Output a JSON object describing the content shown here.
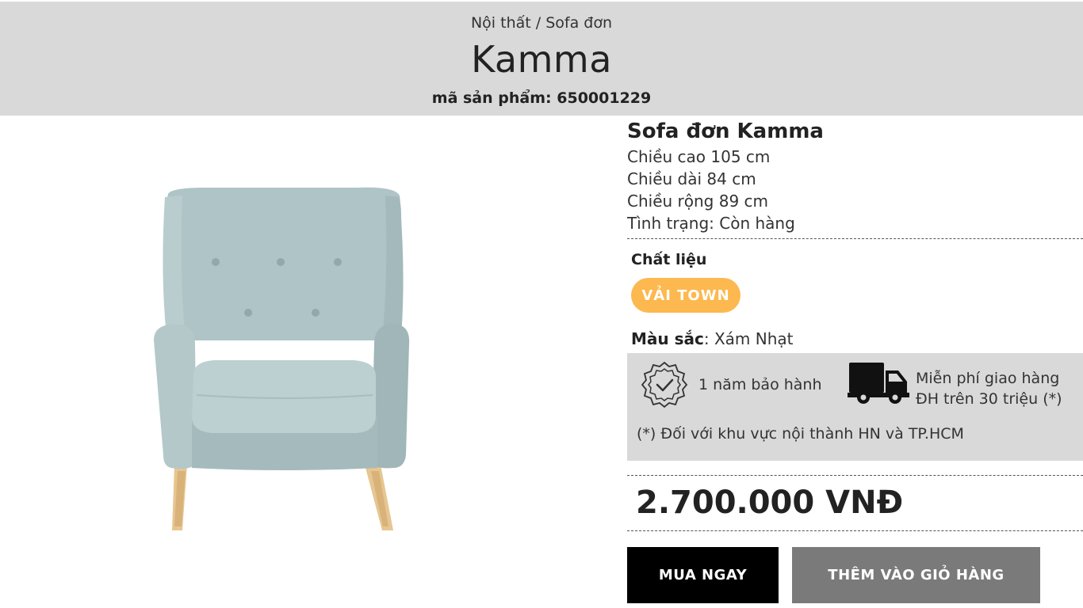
{
  "header": {
    "breadcrumb": [
      "Nội thất",
      "Sofa đơn"
    ],
    "breadcrumb_separator": "/",
    "title": "Kamma",
    "sku_label": "mã sản phẩm:",
    "sku_value": "650001229"
  },
  "product": {
    "name": "Sofa đơn Kamma",
    "specs": [
      "Chiều cao 105 cm",
      "Chiều dài 84 cm",
      "Chiều rộng 89 cm",
      "Tình trạng: Còn hàng"
    ],
    "material_label": "Chất liệu",
    "material_option": "VẢI TOWN",
    "color_label": "Màu sắc",
    "color_value": ": Xám Nhạt",
    "image_icon": "armchair-image"
  },
  "benefits": {
    "warranty": "1 năm bảo hành",
    "warranty_icon": "badge-check-icon",
    "shipping_line1": "Miễn phí giao hàng",
    "shipping_line2": "ĐH trên 30 triệu (*)",
    "shipping_icon": "truck-icon",
    "footnote": "(*) Đối với khu vực nội thành HN và TP.HCM"
  },
  "price": "2.700.000 VNĐ",
  "actions": {
    "buy_now": "MUA NGAY",
    "add_to_cart": "THÊM VÀO GIỎ HÀNG"
  },
  "colors": {
    "header_bg": "#d9d9d9",
    "chip": "#fdb84f",
    "buy_button": "#000000",
    "cart_button": "#7a7a7a",
    "upholstery": "#a9bfc1"
  }
}
